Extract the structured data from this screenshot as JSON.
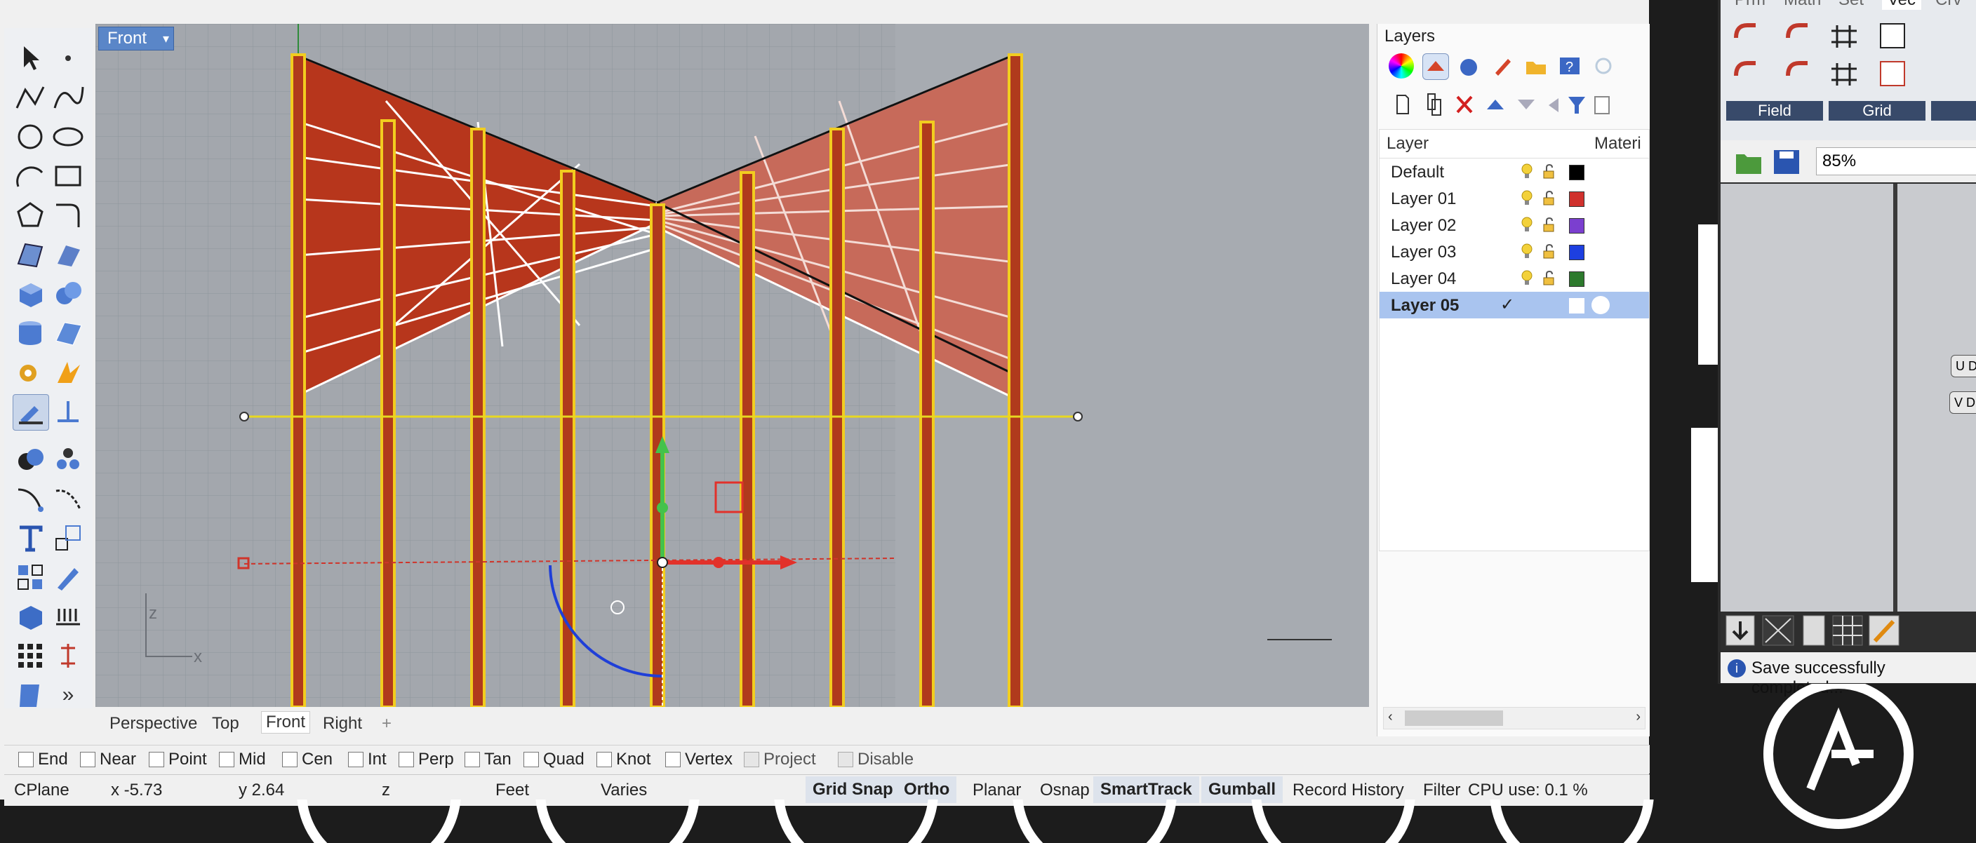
{
  "viewport": {
    "name": "Front",
    "dropdown_glyph": "▾"
  },
  "axis": {
    "z": "z",
    "x": "x"
  },
  "view_tabs": [
    "Perspective",
    "Top",
    "Front",
    "Right"
  ],
  "view_tab_add": "+",
  "osnap": [
    "End",
    "Near",
    "Point",
    "Mid",
    "Cen",
    "Int",
    "Perp",
    "Tan",
    "Quad",
    "Knot",
    "Vertex",
    "Project",
    "Disable"
  ],
  "status": {
    "cplane": "CPlane",
    "x": "x -5.73",
    "y": "y 2.64",
    "z": "z",
    "units": "Feet",
    "layer": "Varies",
    "grid_snap": "Grid Snap",
    "ortho": "Ortho",
    "planar": "Planar",
    "osnap": "Osnap",
    "smarttrack": "SmartTrack",
    "gumball": "Gumball",
    "record_history": "Record History",
    "filter": "Filter",
    "cpu": "CPU use: 0.1 %"
  },
  "layers": {
    "title": "Layers",
    "col_layer": "Layer",
    "col_material": "Materi",
    "rows": [
      {
        "name": "Default",
        "color": "#000000"
      },
      {
        "name": "Layer 01",
        "color": "#d0312d"
      },
      {
        "name": "Layer 02",
        "color": "#7b3fcf"
      },
      {
        "name": "Layer 03",
        "color": "#1d3fe0"
      },
      {
        "name": "Layer 04",
        "color": "#2d7a2d"
      },
      {
        "name": "Layer 05",
        "color": "#ffffff"
      }
    ],
    "current_check": "✓"
  },
  "grasshopper": {
    "top_tabs": [
      "Prm",
      "Math",
      "Set",
      "Vec",
      "Crv"
    ],
    "group_field": "Field",
    "group_grid": "Grid",
    "zoom": "85%",
    "node_ud": "U D",
    "node_vd": "V D",
    "save_message": "Save successfully completed..."
  },
  "colors": {
    "accent": "#5a86c8",
    "surface": "#b5351c",
    "column": "#e8c21a"
  }
}
